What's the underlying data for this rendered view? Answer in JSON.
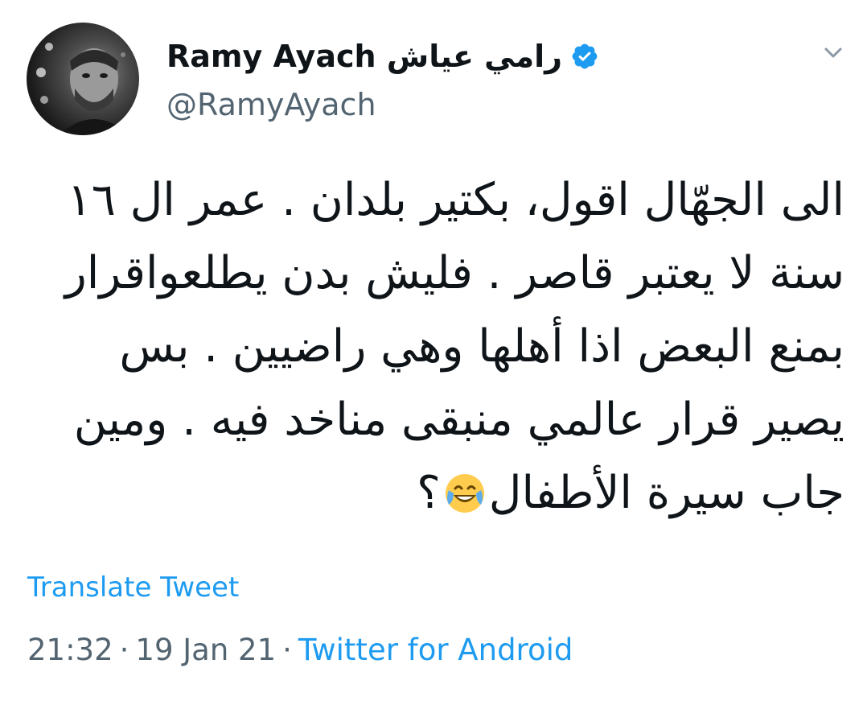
{
  "author": {
    "display_name": "Ramy Ayach رامي عياش",
    "handle": "@RamyAyach",
    "verified_icon": "verified-badge-icon",
    "avatar": "avatar-photo"
  },
  "menu_icon": "chevron-down-icon",
  "tweet": {
    "lines": [
      "الى الجهّال اقول،   بكتير بلدان . عمر ال ١٦",
      "سنة لا يعتبر قاصر . فليش بدن يطلعواقرار",
      "بمنع البعض اذا أهلها وهي راضيين . بس",
      "يصير قرار عالمي منبقى مناخد فيه . ومين",
      "جاب سيرة الأطفال"
    ],
    "last_line_suffix": "؟",
    "emoji_icon": "face-with-tears-of-joy-icon"
  },
  "translate_label": "Translate Tweet",
  "meta": {
    "time": "21:32",
    "separator": "·",
    "date": "19 Jan 21",
    "source": "Twitter for Android"
  },
  "colors": {
    "link": "#1d9bf0",
    "secondary_text": "#536471",
    "primary_text": "#0f1419",
    "verified": "#1d9bf0"
  }
}
